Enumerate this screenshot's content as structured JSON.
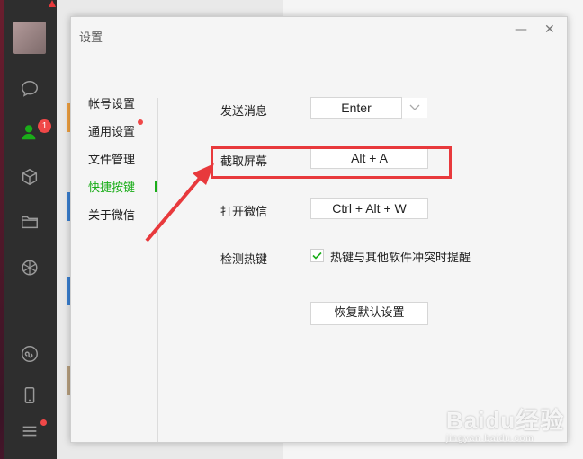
{
  "dialog": {
    "title": "设置",
    "minimize_glyph": "—",
    "close_glyph": "✕"
  },
  "nav": {
    "items": [
      {
        "label": "帐号设置"
      },
      {
        "label": "通用设置"
      },
      {
        "label": "文件管理"
      },
      {
        "label": "快捷按键",
        "active": true
      },
      {
        "label": "关于微信"
      }
    ]
  },
  "shortcuts": {
    "send": {
      "label": "发送消息",
      "value": "Enter"
    },
    "screenshot": {
      "label": "截取屏幕",
      "value": "Alt + A"
    },
    "open": {
      "label": "打开微信",
      "value": "Ctrl + Alt + W"
    },
    "detect": {
      "label": "检测热键",
      "checkbox_label": "热键与其他软件冲突时提醒",
      "checked": true
    },
    "reset_label": "恢复默认设置"
  },
  "sidebar": {
    "contacts_badge": "1",
    "icons": [
      "chat-icon",
      "contacts-icon",
      "favorites-icon",
      "files-icon",
      "moments-icon",
      "miniprogram-icon",
      "phone-icon",
      "menu-icon"
    ]
  },
  "annotation": {
    "highlight_color": "#e8393c"
  },
  "watermark": {
    "main": "Baidu经验",
    "sub": "jingyan.baidu.com"
  },
  "colors": {
    "accent_green": "#1aad19",
    "badge_red": "#f04848"
  }
}
